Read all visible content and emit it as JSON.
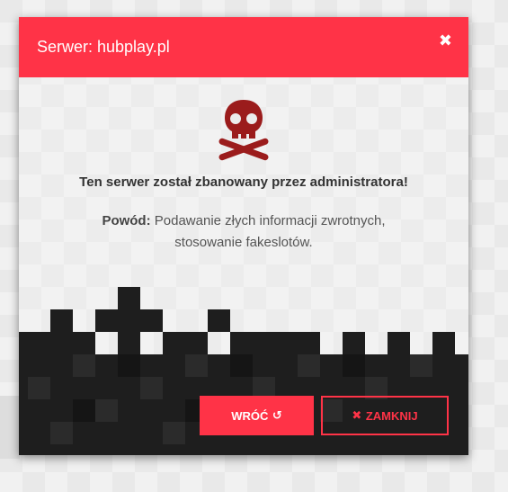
{
  "modal": {
    "title": "Serwer: hubplay.pl",
    "close_icon": "close-icon",
    "icon": "skull-crossbones-icon",
    "accent_color": "#ff3347",
    "headline": "Ten serwer został zbanowany przez administratora!",
    "reason_label": "Powód:",
    "reason_text": "Podawanie złych informacji zwrotnych, stosowanie fakeslotów."
  },
  "buttons": {
    "back_label": "WRÓĆ",
    "back_icon": "undo-icon",
    "close_label": "ZAMKNIJ",
    "close_icon": "times-icon"
  }
}
